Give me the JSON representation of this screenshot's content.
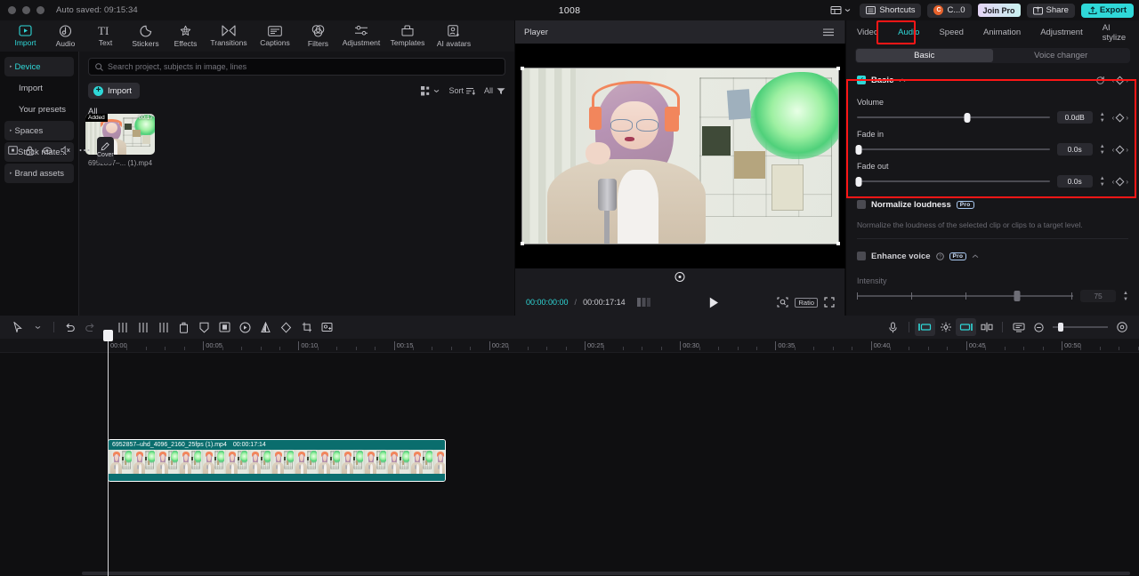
{
  "titlebar": {
    "autosave": "Auto saved: 09:15:34",
    "project_title": "1008",
    "shortcuts_label": "Shortcuts",
    "account_label": "C...0",
    "account_initial": "C",
    "join_pro_label": "Join Pro",
    "share_label": "Share",
    "export_label": "Export"
  },
  "toolbar": {
    "items": [
      {
        "label": "Import",
        "icon": "import-icon",
        "active": true
      },
      {
        "label": "Audio",
        "icon": "audio-icon",
        "active": false
      },
      {
        "label": "Text",
        "icon": "text-icon",
        "active": false
      },
      {
        "label": "Stickers",
        "icon": "stickers-icon",
        "active": false
      },
      {
        "label": "Effects",
        "icon": "effects-icon",
        "active": false
      },
      {
        "label": "Transitions",
        "icon": "transitions-icon",
        "active": false
      },
      {
        "label": "Captions",
        "icon": "captions-icon",
        "active": false
      },
      {
        "label": "Filters",
        "icon": "filters-icon",
        "active": false
      },
      {
        "label": "Adjustment",
        "icon": "adjustment-icon",
        "active": false
      },
      {
        "label": "Templates",
        "icon": "templates-icon",
        "active": false
      },
      {
        "label": "AI avatars",
        "icon": "ai-avatars-icon",
        "active": false
      }
    ]
  },
  "sidebar": {
    "items": [
      {
        "label": "Device",
        "type": "group",
        "selected": true
      },
      {
        "label": "Import",
        "type": "child",
        "selected": false
      },
      {
        "label": "Your presets",
        "type": "child",
        "selected": false
      },
      {
        "label": "Spaces",
        "type": "group",
        "selected": false
      },
      {
        "label": "Stock mate...",
        "type": "group",
        "selected": false
      },
      {
        "label": "Brand assets",
        "type": "group",
        "selected": false
      }
    ]
  },
  "browser": {
    "search_placeholder": "Search project, subjects in image, lines",
    "import_label": "Import",
    "sort_label": "Sort",
    "filter_all_label": "All",
    "section_label": "All",
    "media": [
      {
        "name": "6952857–... (1).mp4",
        "badge": "Added",
        "duration": "00:17"
      }
    ]
  },
  "player": {
    "title": "Player",
    "current_time": "00:00:00:00",
    "time_separator": "/",
    "total_time": "00:00:17:14",
    "ratio_label": "Ratio"
  },
  "properties": {
    "tabs": [
      {
        "label": "Video",
        "active": false
      },
      {
        "label": "Audio",
        "active": true
      },
      {
        "label": "Speed",
        "active": false
      },
      {
        "label": "Animation",
        "active": false
      },
      {
        "label": "Adjustment",
        "active": false
      },
      {
        "label": "AI stylize",
        "active": false
      }
    ],
    "segments": [
      {
        "label": "Basic",
        "on": true
      },
      {
        "label": "Voice changer",
        "on": false
      }
    ],
    "basic": {
      "title": "Basic",
      "checked": true,
      "rows": [
        {
          "label": "Volume",
          "value": "0.0dB",
          "pct": 57
        },
        {
          "label": "Fade in",
          "value": "0.0s",
          "pct": 0
        },
        {
          "label": "Fade out",
          "value": "0.0s",
          "pct": 0
        }
      ]
    },
    "normalize_loudness": {
      "title": "Normalize loudness",
      "pro_badge": "Pro",
      "checked": false,
      "hint": "Normalize the loudness of the selected clip or clips to a target level."
    },
    "enhance_voice": {
      "title": "Enhance voice",
      "pro_badge": "Pro",
      "checked": false,
      "intensity_label": "Intensity",
      "intensity_value": "75",
      "intensity_pct": 74
    }
  },
  "timeline": {
    "tools_left": [
      "select-tool",
      "undo-button",
      "redo-button",
      "split-button",
      "split-left-button",
      "split-right-button",
      "delete-button",
      "mask-button",
      "crop-frame-button",
      "freeze-button",
      "mirror-button",
      "reverse-button",
      "crop-button",
      "snapshot-button"
    ],
    "tools_right": [
      "record-voiceover-button",
      "auto-cut-button",
      "keyframe-button",
      "audio-stretch-button",
      "split-playhead-button",
      "preview-render-button",
      "zoom-out-button",
      "zoom-slider",
      "fit-timeline-button"
    ],
    "ruler_labels": [
      "00:00",
      "00:05",
      "00:10",
      "00:15",
      "00:20",
      "00:25",
      "00:30",
      "00:35",
      "00:40",
      "00:45",
      "00:50"
    ],
    "track_head": {
      "cover_label": "Cover",
      "icons": [
        "track-thumbnail-icon",
        "lock-icon",
        "eye-icon",
        "mute-icon",
        "more-icon"
      ]
    },
    "clip": {
      "name": "6952857–uhd_4096_2160_25fps (1).mp4",
      "duration": "00:00:17:14"
    },
    "playhead_time": "00:00"
  },
  "colors": {
    "accent": "#2fd8d8",
    "highlight_red": "#ff1616",
    "clip_teal": "#0c7d7d",
    "panel_bg": "#161619"
  }
}
